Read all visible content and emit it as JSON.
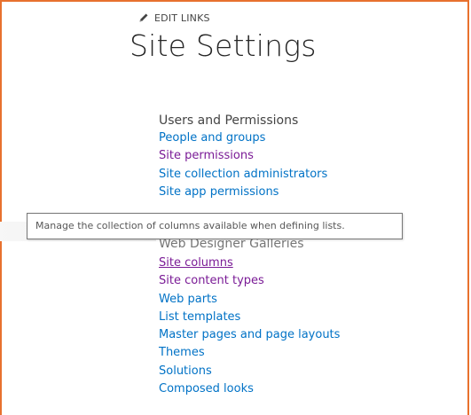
{
  "toolbar": {
    "edit_links_label": "EDIT LINKS",
    "edit_icon": "pencil-icon"
  },
  "page": {
    "title": "Site Settings"
  },
  "sections": [
    {
      "heading": "Users and Permissions",
      "links": [
        {
          "label": "People and groups"
        },
        {
          "label": "Site permissions"
        },
        {
          "label": "Site collection administrators"
        },
        {
          "label": "Site app permissions"
        }
      ]
    },
    {
      "heading": "Web Designer Galleries",
      "links": [
        {
          "label": "Site columns"
        },
        {
          "label": "Site content types"
        },
        {
          "label": "Web parts"
        },
        {
          "label": "List templates"
        },
        {
          "label": "Master pages and page layouts"
        },
        {
          "label": "Themes"
        },
        {
          "label": "Solutions"
        },
        {
          "label": "Composed looks"
        }
      ]
    }
  ],
  "tooltip": {
    "text": "Manage the collection of columns available when defining lists."
  },
  "colors": {
    "link": "#0072c6",
    "visited_link": "#7a1b96",
    "frame": "#e8712e"
  }
}
